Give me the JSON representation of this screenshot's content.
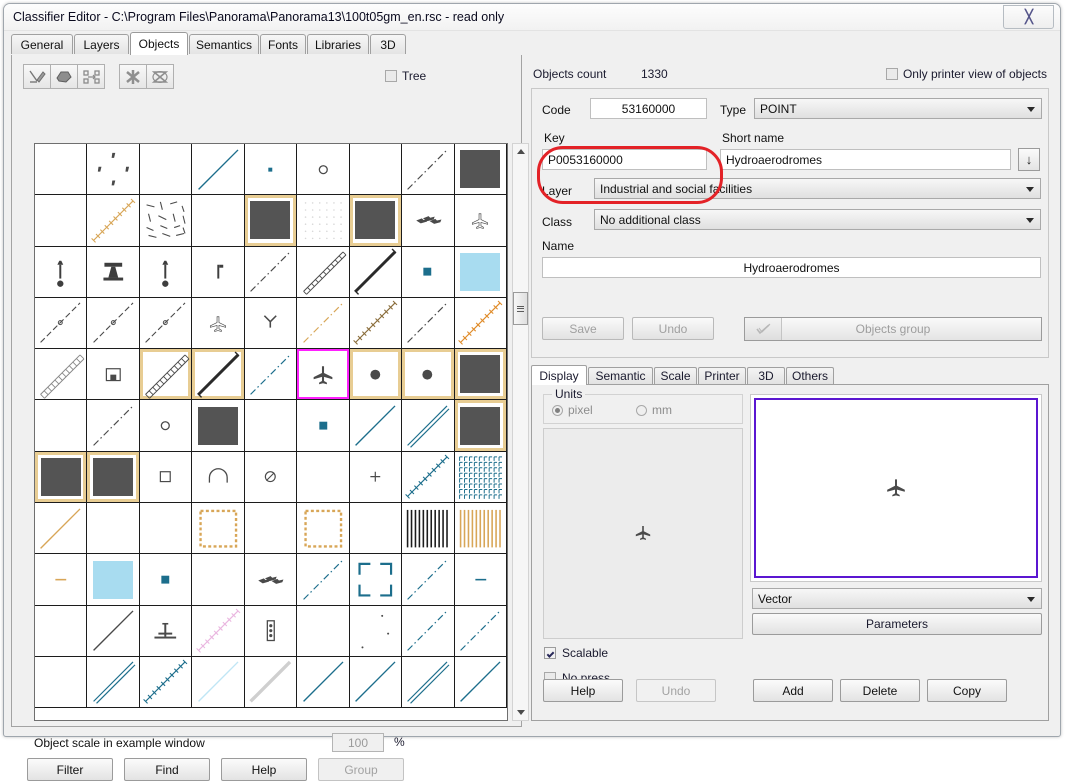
{
  "window": {
    "title": "Classifier Editor - C:\\Program Files\\Panorama\\Panorama13\\100t05gm_en.rsc - read only",
    "close_label": "✕"
  },
  "tabs": [
    {
      "label": "General",
      "active": false
    },
    {
      "label": "Layers",
      "active": false
    },
    {
      "label": "Objects",
      "active": true
    },
    {
      "label": "Semantics",
      "active": false
    },
    {
      "label": "Fonts",
      "active": false
    },
    {
      "label": "Libraries",
      "active": false
    },
    {
      "label": "3D",
      "active": false
    }
  ],
  "left": {
    "toolbar_icons": [
      "edit-pencil-icon",
      "polygon-icon",
      "align-objects-icon",
      "delete-all-icon",
      "clear-selection-icon"
    ],
    "tree_checkbox": {
      "label": "Tree",
      "checked": false
    },
    "scale_label": "Object scale in example window",
    "scale_value": "100",
    "percent": "%",
    "buttons": [
      {
        "label": "Filter",
        "disabled": false
      },
      {
        "label": "Find",
        "disabled": false
      },
      {
        "label": "Help",
        "disabled": false
      },
      {
        "label": "Group",
        "disabled": true
      }
    ]
  },
  "right": {
    "objects_count_label": "Objects count",
    "objects_count_value": "1330",
    "printer_checkbox": {
      "label": "Only printer view of objects",
      "checked": false
    },
    "code_label": "Code",
    "code_value": "53160000",
    "type_label": "Type",
    "type_value": "POINT",
    "key_label": "Key",
    "key_value": "P0053160000",
    "short_name_label": "Short name",
    "short_name_value": "Hydroaerodromes",
    "layer_label": "Layer",
    "layer_value": "Industrial and social facilities",
    "class_label": "Class",
    "class_value": "No additional class",
    "name_label": "Name",
    "name_value": "Hydroaerodromes",
    "save_label": "Save",
    "undo_label": "Undo",
    "objects_group_label": "Objects group",
    "subtabs": [
      {
        "label": "Display",
        "active": true
      },
      {
        "label": "Semantic",
        "active": false
      },
      {
        "label": "Scale",
        "active": false
      },
      {
        "label": "Printer",
        "active": false
      },
      {
        "label": "3D",
        "active": false
      },
      {
        "label": "Others",
        "active": false
      }
    ],
    "units_caption": "Units",
    "unit_pixel": "pixel",
    "unit_mm": "mm",
    "unit_selected": "pixel",
    "vector_value": "Vector",
    "parameters_label": "Parameters",
    "scalable_checkbox": {
      "label": "Scalable",
      "checked": true
    },
    "nopress_checkbox": {
      "label": "No press",
      "checked": false
    },
    "bottom_buttons": [
      {
        "label": "Help",
        "disabled": false
      },
      {
        "label": "Undo",
        "disabled": true
      },
      {
        "label": "Add",
        "disabled": false
      },
      {
        "label": "Delete",
        "disabled": false
      },
      {
        "label": "Copy",
        "disabled": false
      }
    ]
  },
  "symbol_grid": {
    "columns": 9,
    "rows": 11,
    "selected_index": 47,
    "cells": [
      {
        "t": "empty"
      },
      {
        "t": "dots4"
      },
      {
        "t": "empty"
      },
      {
        "t": "line",
        "c": "#1c6e8c",
        "s": "solid"
      },
      {
        "t": "dot",
        "c": "#1c6e8c"
      },
      {
        "t": "circle",
        "c": "#4a4a4a"
      },
      {
        "t": "empty"
      },
      {
        "t": "line",
        "c": "#4a4a4a",
        "s": "dashdot"
      },
      {
        "t": "fill",
        "c": "#545454"
      },
      {
        "t": "empty"
      },
      {
        "t": "line",
        "c": "#d8a657",
        "s": "ticked"
      },
      {
        "t": "scatter"
      },
      {
        "t": "empty"
      },
      {
        "t": "fill",
        "c": "#545454",
        "sel": "gold"
      },
      {
        "t": "dotgrid",
        "c": "#d8d8d8"
      },
      {
        "t": "fill",
        "c": "#545454",
        "sel": "gold"
      },
      {
        "t": "planes3"
      },
      {
        "t": "plane-small"
      },
      {
        "t": "tower"
      },
      {
        "t": "tower2"
      },
      {
        "t": "tower"
      },
      {
        "t": "pole"
      },
      {
        "t": "line",
        "c": "#4a4a4a",
        "s": "dashdot"
      },
      {
        "t": "line",
        "c": "#4a4a4a",
        "s": "hatched"
      },
      {
        "t": "line",
        "c": "#2a2a2a",
        "s": "thick-hatch"
      },
      {
        "t": "square",
        "c": "#1c6e8c"
      },
      {
        "t": "fill",
        "c": "#a8dcf0"
      },
      {
        "t": "line",
        "c": "#4a4a4a",
        "s": "circ"
      },
      {
        "t": "line",
        "c": "#4a4a4a",
        "s": "circ"
      },
      {
        "t": "line",
        "c": "#4a4a4a",
        "s": "circ"
      },
      {
        "t": "plane-small"
      },
      {
        "t": "wye"
      },
      {
        "t": "line",
        "c": "#d8a657",
        "s": "dashdot"
      },
      {
        "t": "line",
        "c": "#8a6d3b",
        "s": "ticked"
      },
      {
        "t": "line",
        "c": "#4a4a4a",
        "s": "dashdot"
      },
      {
        "t": "line",
        "c": "#e08b28",
        "s": "ticked"
      },
      {
        "t": "line",
        "c": "#888",
        "s": "ladder"
      },
      {
        "t": "boxicon"
      },
      {
        "t": "line",
        "c": "#4a4a4a",
        "s": "ladder",
        "sel": "gold"
      },
      {
        "t": "line",
        "c": "#2a2a2a",
        "s": "thick-hatch",
        "sel": "gold"
      },
      {
        "t": "line",
        "c": "#1c6e8c",
        "s": "dashdot"
      },
      {
        "t": "plane",
        "sel": "magenta"
      },
      {
        "t": "bigdot",
        "c": "#4a4a4a",
        "sel": "gold"
      },
      {
        "t": "bigdot",
        "c": "#4a4a4a",
        "sel": "gold"
      },
      {
        "t": "fill",
        "c": "#545454",
        "sel": "gold"
      },
      {
        "t": "empty"
      },
      {
        "t": "line",
        "c": "#4a4a4a",
        "s": "dashdot"
      },
      {
        "t": "circle",
        "c": "#4a4a4a"
      },
      {
        "t": "fill",
        "c": "#545454"
      },
      {
        "t": "empty"
      },
      {
        "t": "square",
        "c": "#1c6e8c"
      },
      {
        "t": "line",
        "c": "#1c6e8c",
        "s": "solid"
      },
      {
        "t": "line",
        "c": "#1c6e8c",
        "s": "double"
      },
      {
        "t": "fill",
        "c": "#545454",
        "sel": "gold"
      },
      {
        "t": "fill",
        "c": "#545454",
        "sel": "gold"
      },
      {
        "t": "fill",
        "c": "#545454",
        "sel": "gold"
      },
      {
        "t": "smallsquare"
      },
      {
        "t": "arch"
      },
      {
        "t": "circledot"
      },
      {
        "t": "empty"
      },
      {
        "t": "plus"
      },
      {
        "t": "line",
        "c": "#1c6e8c",
        "s": "ticked"
      },
      {
        "t": "texture",
        "c": "#1c6e8c"
      },
      {
        "t": "line",
        "c": "#d8a657",
        "s": "solid"
      },
      {
        "t": "empty"
      },
      {
        "t": "empty"
      },
      {
        "t": "dashbox",
        "c": "#d8a657"
      },
      {
        "t": "empty"
      },
      {
        "t": "dashbox",
        "c": "#d8a657"
      },
      {
        "t": "empty"
      },
      {
        "t": "vbars",
        "c": "#1c1c1c"
      },
      {
        "t": "vbars",
        "c": "#d8a657"
      },
      {
        "t": "dash",
        "c": "#d8a657"
      },
      {
        "t": "fill",
        "c": "#a8dcf0"
      },
      {
        "t": "square",
        "c": "#1c6e8c"
      },
      {
        "t": "empty"
      },
      {
        "t": "planes3"
      },
      {
        "t": "line",
        "c": "#1c6e8c",
        "s": "dashdot"
      },
      {
        "t": "cornerbox",
        "c": "#1c6e8c"
      },
      {
        "t": "line",
        "c": "#1c6e8c",
        "s": "dashdot"
      },
      {
        "t": "dash",
        "c": "#1c6e8c"
      },
      {
        "t": "empty"
      },
      {
        "t": "line",
        "c": "#4a4a4a",
        "s": "solid"
      },
      {
        "t": "antenna"
      },
      {
        "t": "line",
        "c": "#eab6e0",
        "s": "ticked"
      },
      {
        "t": "trafficlight"
      },
      {
        "t": "empty"
      },
      {
        "t": "speckle"
      },
      {
        "t": "line",
        "c": "#1c6e8c",
        "s": "dashdot"
      },
      {
        "t": "line",
        "c": "#1c6e8c",
        "s": "dashdot"
      },
      {
        "t": "empty"
      },
      {
        "t": "line",
        "c": "#1c6e8c",
        "s": "double"
      },
      {
        "t": "line",
        "c": "#1c6e8c",
        "s": "ticked"
      },
      {
        "t": "line",
        "c": "#bfe6f5",
        "s": "solid"
      },
      {
        "t": "line",
        "c": "#cfcfcf",
        "s": "thick"
      },
      {
        "t": "line",
        "c": "#1c6e8c",
        "s": "solid"
      },
      {
        "t": "line",
        "c": "#1c6e8c",
        "s": "solid"
      },
      {
        "t": "line",
        "c": "#1c6e8c",
        "s": "double"
      },
      {
        "t": "line",
        "c": "#1c6e8c",
        "s": "solid"
      }
    ]
  },
  "colors": {
    "accent_selected": "#ff20ff",
    "accent_gold": "#e8cd93",
    "preview_border": "#5b17d1",
    "annotation_red": "#e32227",
    "window_bg": "#f0f0f0"
  }
}
